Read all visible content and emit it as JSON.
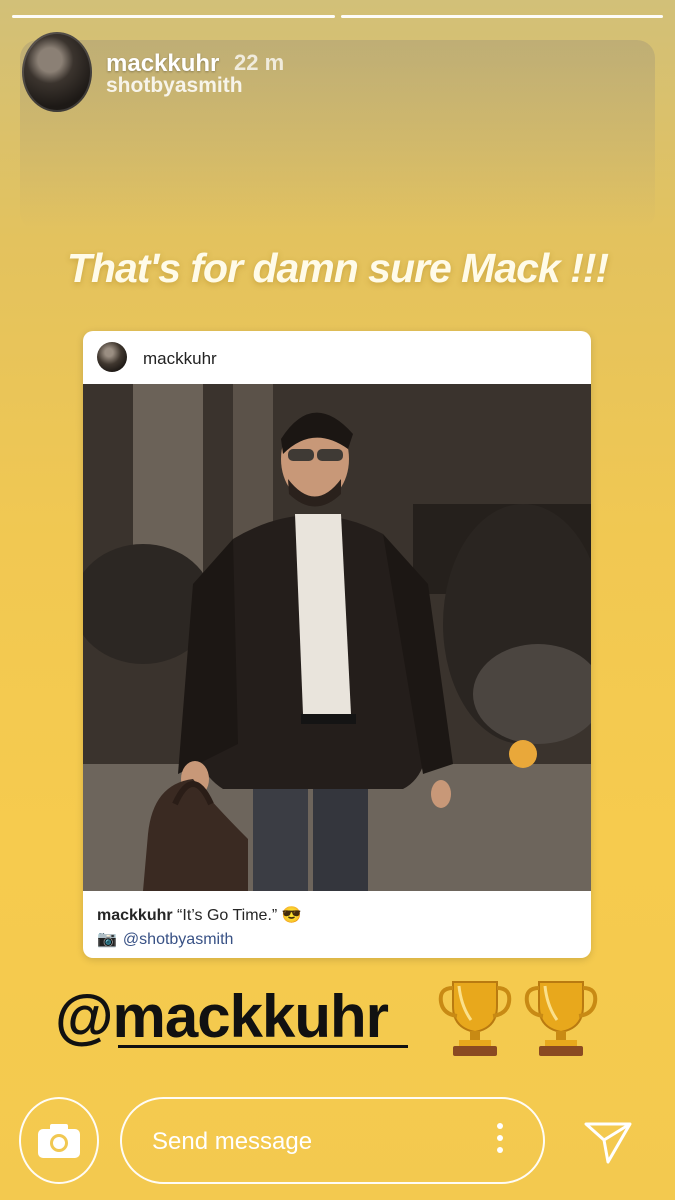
{
  "story": {
    "progress_segments": 2,
    "header": {
      "username": "mackkuhr",
      "time": "22 m",
      "subname": "shotbyasmith"
    },
    "caption": "That's for damn sure Mack !!!",
    "post_card": {
      "username": "mackkuhr",
      "caption_user": "mackkuhr",
      "caption_text": "“It’s Go Time.” 😎",
      "credit_icon": "camera-icon",
      "credit": "@shotbyasmith"
    },
    "mention": "@mackkuhr",
    "stickers": [
      "trophy-icon",
      "trophy-icon"
    ]
  },
  "footer": {
    "message_placeholder": "Send message",
    "camera_icon": "camera-icon",
    "more_icon": "more-vertical-icon",
    "send_icon": "send-icon"
  },
  "colors": {
    "background_top": "#d2c078",
    "background_bottom": "#f3c94f",
    "caption_text": "#fffbe8",
    "mention_text": "#111111",
    "credit_link": "#385185"
  }
}
